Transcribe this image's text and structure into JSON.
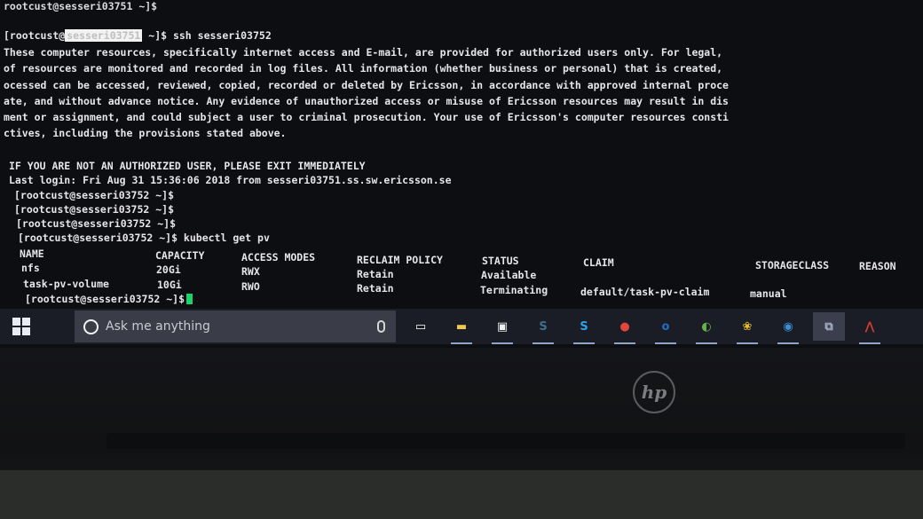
{
  "terminal": {
    "lines": [
      {
        "text": "rootcust@sesseri03751 ~]$"
      },
      {
        "prompt": "[rootcust@",
        "host_redacted": "sesseri03751",
        "suffix": " ~]$ ssh sesseri03752"
      },
      {
        "text": "These computer resources, specifically internet access and E-mail, are provided for authorized users only. For legal,"
      },
      {
        "text": "of resources are monitored and recorded in log files. All information (whether business or personal) that is created,"
      },
      {
        "text": "ocessed can be accessed, reviewed, copied, recorded or deleted by Ericsson, in accordance with approved internal proce"
      },
      {
        "text": "ate, and without advance notice. Any evidence of unauthorized access or misuse of Ericsson resources may result in dis"
      },
      {
        "text": "ment or assignment, and could subject a user to criminal prosecution. Your use of Ericsson's computer resources consti"
      },
      {
        "text": "ctives, including the provisions stated above."
      },
      {
        "text": ""
      },
      {
        "text": "IF YOU ARE NOT AN AUTHORIZED USER, PLEASE EXIT IMMEDIATELY"
      },
      {
        "text": "Last login: Fri Aug 31 15:36:06 2018 from sesseri03751.ss.sw.ericsson.se"
      },
      {
        "text": "[rootcust@sesseri03752 ~]$"
      },
      {
        "text": "[rootcust@sesseri03752 ~]$"
      },
      {
        "text": "[rootcust@sesseri03752 ~]$"
      },
      {
        "text": "[rootcust@sesseri03752 ~]$ kubectl get pv"
      }
    ],
    "pv_table": {
      "headers": [
        "NAME",
        "CAPACITY",
        "ACCESS MODES",
        "RECLAIM POLICY",
        "STATUS",
        "CLAIM",
        "STORAGECLASS",
        "REASON"
      ],
      "rows": [
        [
          "nfs",
          "20Gi",
          "RWX",
          "Retain",
          "Available",
          "",
          "",
          ""
        ],
        [
          "task-pv-volume",
          "10Gi",
          "RWO",
          "Retain",
          "Terminating",
          "default/task-pv-claim",
          "manual",
          ""
        ]
      ]
    },
    "final_prompt": "[rootcust@sesseri03752 ~]$"
  },
  "taskbar": {
    "search_placeholder": "Ask me anything",
    "apps": [
      {
        "icon": "task-view-icon",
        "glyph": "▭"
      },
      {
        "icon": "file-explorer-icon",
        "glyph": "▬",
        "color": "#f2c94c"
      },
      {
        "icon": "store-icon",
        "glyph": "▣",
        "color": "#f0f0f0"
      },
      {
        "icon": "app-s-icon",
        "glyph": "S",
        "color": "#3f6e8c"
      },
      {
        "icon": "skype-icon",
        "glyph": "S",
        "color": "#2aa3e6"
      },
      {
        "icon": "chrome-icon",
        "glyph": "●",
        "color": "#e2463a"
      },
      {
        "icon": "outlook-icon",
        "glyph": "o",
        "color": "#1e6fc2"
      },
      {
        "icon": "app-green-icon",
        "glyph": "◐",
        "color": "#6ab04c"
      },
      {
        "icon": "app-paint-icon",
        "glyph": "❀",
        "color": "#e6c229"
      },
      {
        "icon": "app-globe-icon",
        "glyph": "◉",
        "color": "#3a8fd9"
      },
      {
        "icon": "network-icon",
        "glyph": "⧉",
        "color": "#aab4c4"
      },
      {
        "icon": "pdf-icon",
        "glyph": "⋀",
        "color": "#d13b2f"
      }
    ]
  },
  "device": {
    "logo": "hp"
  }
}
